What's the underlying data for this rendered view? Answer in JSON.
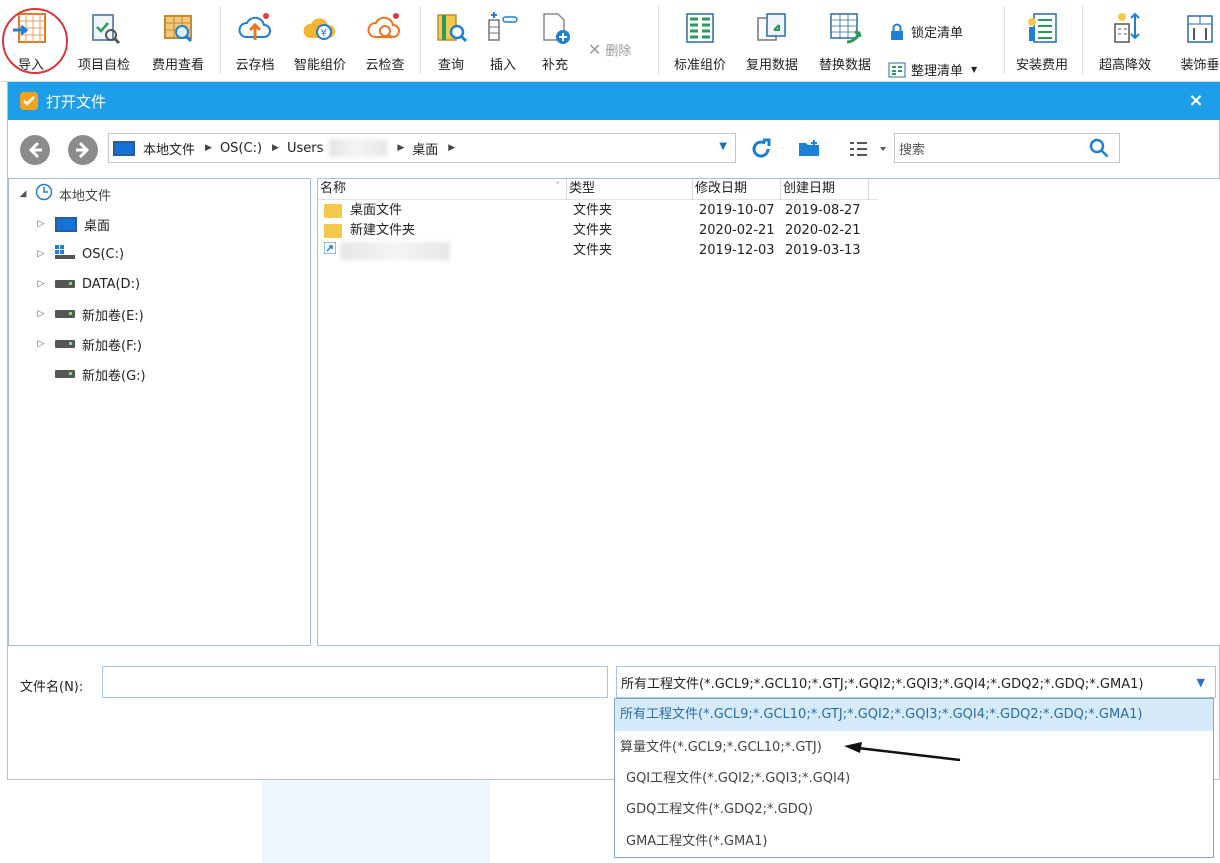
{
  "toolbar": {
    "import": "导入",
    "self_check": "项目自检",
    "fee_view": "费用查看",
    "cloud_archive": "云存档",
    "smart_price": "智能组价",
    "cloud_check": "云检查",
    "query": "查询",
    "insert": "插入",
    "supplement": "补充",
    "delete": "删除",
    "std_price": "标准组价",
    "reuse_data": "复用数据",
    "replace_data": "替换数据",
    "lock_list": "锁定清单",
    "organize_list": "整理清单",
    "install_fee": "安装费用",
    "high_reduce": "超高降效",
    "decor_vertical": "装饰垂"
  },
  "dialog": {
    "title": "打开文件",
    "close": "×",
    "address": {
      "root": "本地文件",
      "drive": "OS(C:)",
      "users": "Users",
      "desktop": "桌面"
    },
    "search_placeholder": "搜索",
    "tree": {
      "root": "本地文件",
      "items": [
        {
          "label": "桌面"
        },
        {
          "label": "OS(C:)"
        },
        {
          "label": "DATA(D:)"
        },
        {
          "label": "新加卷(E:)"
        },
        {
          "label": "新加卷(F:)"
        },
        {
          "label": "新加卷(G:)"
        }
      ]
    },
    "columns": {
      "name": "名称",
      "type": "类型",
      "modified": "修改日期",
      "created": "创建日期"
    },
    "rows": [
      {
        "name": "桌面文件",
        "type": "文件夹",
        "modified": "2019-10-07",
        "created": "2019-08-27"
      },
      {
        "name": "新建文件夹",
        "type": "文件夹",
        "modified": "2020-02-21",
        "created": "2020-02-21"
      },
      {
        "name": "",
        "type": "文件夹",
        "modified": "2019-12-03",
        "created": "2019-03-13"
      }
    ],
    "filename_label": "文件名(N):",
    "filter_selected": "所有工程文件(*.GCL9;*.GCL10;*.GTJ;*.GQI2;*.GQI3;*.GQI4;*.GDQ2;*.GDQ;*.GMA1)",
    "filter_options": [
      "所有工程文件(*.GCL9;*.GCL10;*.GTJ;*.GQI2;*.GQI3;*.GQI4;*.GDQ2;*.GDQ;*.GMA1)",
      "算量文件(*.GCL9;*.GCL10;*.GTJ)",
      "GQI工程文件(*.GQI2;*.GQI3;*.GQI4)",
      "GDQ工程文件(*.GDQ2;*.GDQ)",
      "GMA工程文件(*.GMA1)"
    ]
  },
  "colors": {
    "title_bar": "#1e9ee8",
    "selected_option": "#d6ebf9",
    "annotation": "#d9363e"
  }
}
